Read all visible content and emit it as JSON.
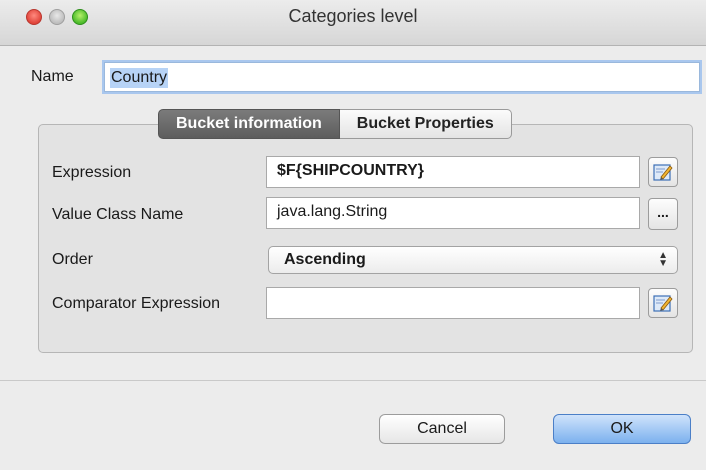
{
  "window": {
    "title": "Categories level"
  },
  "name_field": {
    "label": "Name",
    "value": "Country"
  },
  "tabs": [
    {
      "label": "Bucket information",
      "active": true
    },
    {
      "label": "Bucket Properties",
      "active": false
    }
  ],
  "form": {
    "expression": {
      "label": "Expression",
      "value": "$F{SHIPCOUNTRY}"
    },
    "value_class_name": {
      "label": "Value Class Name",
      "value": "java.lang.String",
      "browse_label": "..."
    },
    "order": {
      "label": "Order",
      "selected": "Ascending"
    },
    "comparator_expression": {
      "label": "Comparator Expression",
      "value": ""
    }
  },
  "buttons": {
    "cancel": "Cancel",
    "ok": "OK"
  },
  "icons": {
    "close": "close-icon",
    "minimize": "minimize-icon",
    "zoom": "zoom-icon",
    "edit_expression": "edit-expression-icon",
    "edit_comparator": "edit-expression-icon",
    "select_arrows": "up-down-arrows-icon"
  },
  "colors": {
    "accent": "#7cb1ee",
    "selection": "#b7d3f6",
    "active_tab": "#5d5d5d"
  }
}
